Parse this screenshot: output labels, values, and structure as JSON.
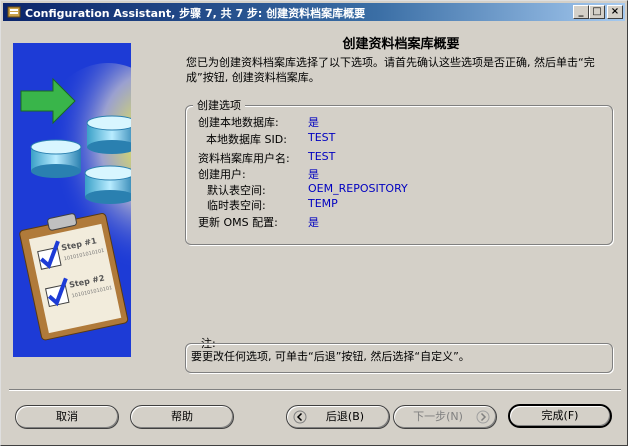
{
  "window": {
    "title": "Configuration Assistant, 步骤 7, 共 7 步: 创建资料档案库概要",
    "controls": {
      "minimize": "_",
      "maximize": "□",
      "close": "×"
    }
  },
  "main": {
    "heading": "创建资料档案库概要",
    "intro": "您已为创建资料档案库选择了以下选项。请首先确认这些选项是否正确, 然后单击“完成”按钮, 创建资料档案库。"
  },
  "options": {
    "group_label": "创建选项",
    "rows": [
      {
        "label": "创建本地数据库:",
        "value": "是"
      },
      {
        "label": "本地数据库 SID:",
        "value": "TEST"
      },
      {
        "label": "资料档案库用户名:",
        "value": "TEST"
      },
      {
        "label": "创建用户:",
        "value": "是"
      },
      {
        "label": "默认表空间:",
        "value": "OEM_REPOSITORY"
      },
      {
        "label": "临时表空间:",
        "value": "TEMP"
      },
      {
        "label": "更新 OMS 配置:",
        "value": "是"
      }
    ]
  },
  "note": {
    "label": "注:",
    "text": "要更改任何选项, 可单击“后退”按钮, 然后选择“自定义”。"
  },
  "buttons": {
    "cancel": "取消",
    "help": "帮助",
    "back": "后退(B)",
    "next": "下一步(N)",
    "finish": "完成(F)"
  },
  "image": {
    "step1": "Step #1",
    "step2": "Step #2",
    "binary": "1010101010101"
  },
  "colors": {
    "title_bar": "#0a246a",
    "value_text": "#0000c0",
    "side_panel": "#1d3bd6"
  }
}
